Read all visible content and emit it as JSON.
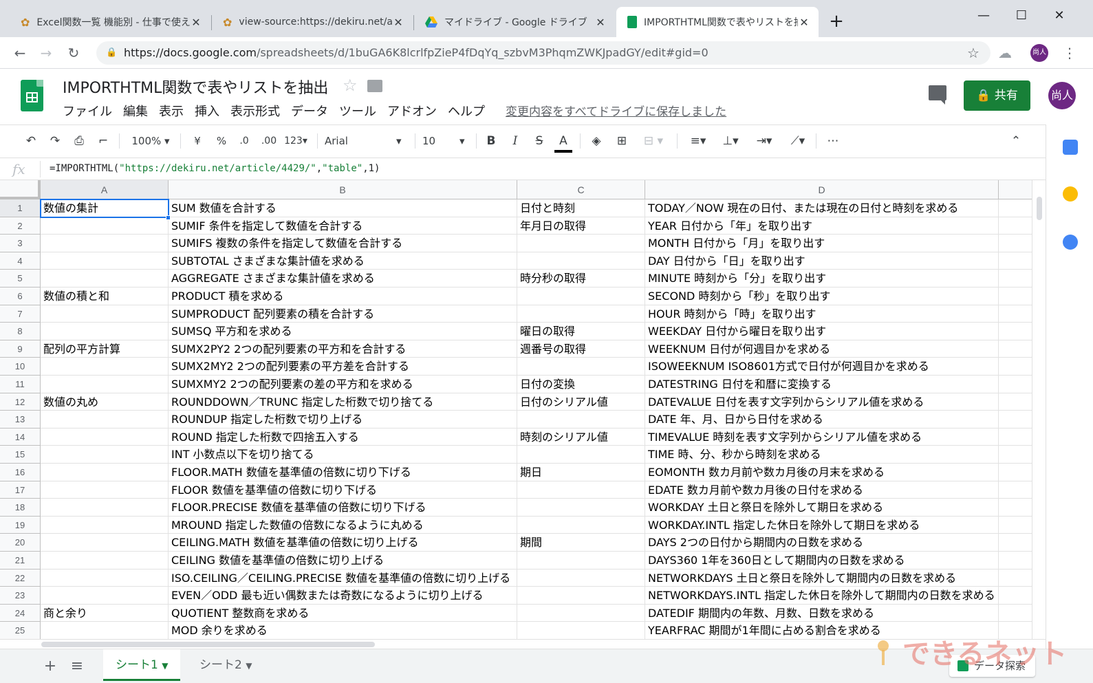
{
  "browser": {
    "tabs": [
      {
        "title": "Excel関数一覧 機能別 - 仕事で使え",
        "active": false
      },
      {
        "title": "view-source:https://dekiru.net/ar",
        "active": false
      },
      {
        "title": "マイドライブ - Google ドライブ",
        "active": false
      },
      {
        "title": "IMPORTHTML関数で表やリストを抽",
        "active": true
      }
    ],
    "new_tab": "+",
    "url_host": "https://docs.google.com",
    "url_path": "/spreadsheets/d/1buGA6K8lcrlfpZieP4fDqYq_szbvM3PhqmZWKJpadGY/edit#gid=0",
    "profile_initial": "尚人"
  },
  "doc": {
    "title": "IMPORTHTML関数で表やリストを抽出",
    "menu": [
      "ファイル",
      "編集",
      "表示",
      "挿入",
      "表示形式",
      "データ",
      "ツール",
      "アドオン",
      "ヘルプ"
    ],
    "save_status": "変更内容をすべてドライブに保存しました",
    "share_label": "共有",
    "avatar": "尚人"
  },
  "toolbar": {
    "zoom": "100%",
    "currency": "¥",
    "percent": "%",
    "dec_less": ".0",
    "dec_more": ".00",
    "format": "123",
    "font": "Arial",
    "font_size": "10",
    "bold": "B",
    "italic": "I",
    "strike": "S",
    "text_color": "A",
    "more": "⋯"
  },
  "formula": {
    "fx": "fx",
    "prefix": "=IMPORTHTML(",
    "arg1": "\"https://dekiru.net/article/4429/\"",
    "sep1": ",",
    "arg2": "\"table\"",
    "suffix": ",1)"
  },
  "grid": {
    "columns": [
      "A",
      "B",
      "C",
      "D"
    ],
    "rows": [
      [
        "数値の集計",
        "SUM 数値を合計する",
        "日付と時刻",
        "TODAY／NOW 現在の日付、または現在の日付と時刻を求める"
      ],
      [
        "",
        "SUMIF 条件を指定して数値を合計する",
        "年月日の取得",
        "YEAR 日付から「年」を取り出す"
      ],
      [
        "",
        "SUMIFS 複数の条件を指定して数値を合計する",
        "",
        "MONTH 日付から「月」を取り出す"
      ],
      [
        "",
        "SUBTOTAL さまざまな集計値を求める",
        "",
        "DAY 日付から「日」を取り出す"
      ],
      [
        "",
        "AGGREGATE さまざまな集計値を求める",
        "時分秒の取得",
        "MINUTE 時刻から「分」を取り出す"
      ],
      [
        "数値の積と和",
        "PRODUCT 積を求める",
        "",
        "SECOND 時刻から「秒」を取り出す"
      ],
      [
        "",
        "SUMPRODUCT 配列要素の積を合計する",
        "",
        "HOUR 時刻から「時」を取り出す"
      ],
      [
        "",
        "SUMSQ 平方和を求める",
        "曜日の取得",
        "WEEKDAY 日付から曜日を取り出す"
      ],
      [
        "配列の平方計算",
        "SUMX2PY2 2つの配列要素の平方和を合計する",
        "週番号の取得",
        "WEEKNUM 日付が何週目かを求める"
      ],
      [
        "",
        "SUMX2MY2 2つの配列要素の平方差を合計する",
        "",
        "ISOWEEKNUM ISO8601方式で日付が何週目かを求める"
      ],
      [
        "",
        "SUMXMY2 2つの配列要素の差の平方和を求める",
        "日付の変換",
        "DATESTRING 日付を和暦に変換する"
      ],
      [
        "数値の丸め",
        "ROUNDDOWN／TRUNC 指定した桁数で切り捨てる",
        "日付のシリアル値",
        "DATEVALUE 日付を表す文字列からシリアル値を求める"
      ],
      [
        "",
        "ROUNDUP 指定した桁数で切り上げる",
        "",
        "DATE 年、月、日から日付を求める"
      ],
      [
        "",
        "ROUND 指定した桁数で四捨五入する",
        "時刻のシリアル値",
        "TIMEVALUE 時刻を表す文字列からシリアル値を求める"
      ],
      [
        "",
        "INT 小数点以下を切り捨てる",
        "",
        "TIME 時、分、秒から時刻を求める"
      ],
      [
        "",
        "FLOOR.MATH 数値を基準値の倍数に切り下げる",
        "期日",
        "EOMONTH 数カ月前や数カ月後の月末を求める"
      ],
      [
        "",
        "FLOOR 数値を基準値の倍数に切り下げる",
        "",
        "EDATE 数カ月前や数カ月後の日付を求める"
      ],
      [
        "",
        "FLOOR.PRECISE 数値を基準値の倍数に切り下げる",
        "",
        "WORKDAY 土日と祭日を除外して期日を求める"
      ],
      [
        "",
        "MROUND 指定した数値の倍数になるように丸める",
        "",
        "WORKDAY.INTL 指定した休日を除外して期日を求める"
      ],
      [
        "",
        "CEILING.MATH 数値を基準値の倍数に切り上げる",
        "期間",
        "DAYS 2つの日付から期間内の日数を求める"
      ],
      [
        "",
        "CEILING 数値を基準値の倍数に切り上げる",
        "",
        "DAYS360 1年を360日として期間内の日数を求める"
      ],
      [
        "",
        "ISO.CEILING／CEILING.PRECISE 数値を基準値の倍数に切り上げる",
        "",
        "NETWORKDAYS 土日と祭日を除外して期間内の日数を求める"
      ],
      [
        "",
        "EVEN／ODD 最も近い偶数または奇数になるように切り上げる",
        "",
        "NETWORKDAYS.INTL 指定した休日を除外して期間内の日数を求める"
      ],
      [
        "商と余り",
        "QUOTIENT 整数商を求める",
        "",
        "DATEDIF 期間内の年数、月数、日数を求める"
      ],
      [
        "",
        "MOD 余りを求める",
        "",
        "YEARFRAC 期間が1年間に占める割合を求める"
      ]
    ]
  },
  "sheets": {
    "tabs": [
      "シート1",
      "シート2"
    ],
    "active": 0,
    "explore_label": "データ探索"
  },
  "watermark": "できるネット",
  "colors": {
    "sheets_green": "#0f9d58",
    "share_green": "#188038",
    "selection_blue": "#1a73e8",
    "avatar_purple": "#6d2883"
  }
}
